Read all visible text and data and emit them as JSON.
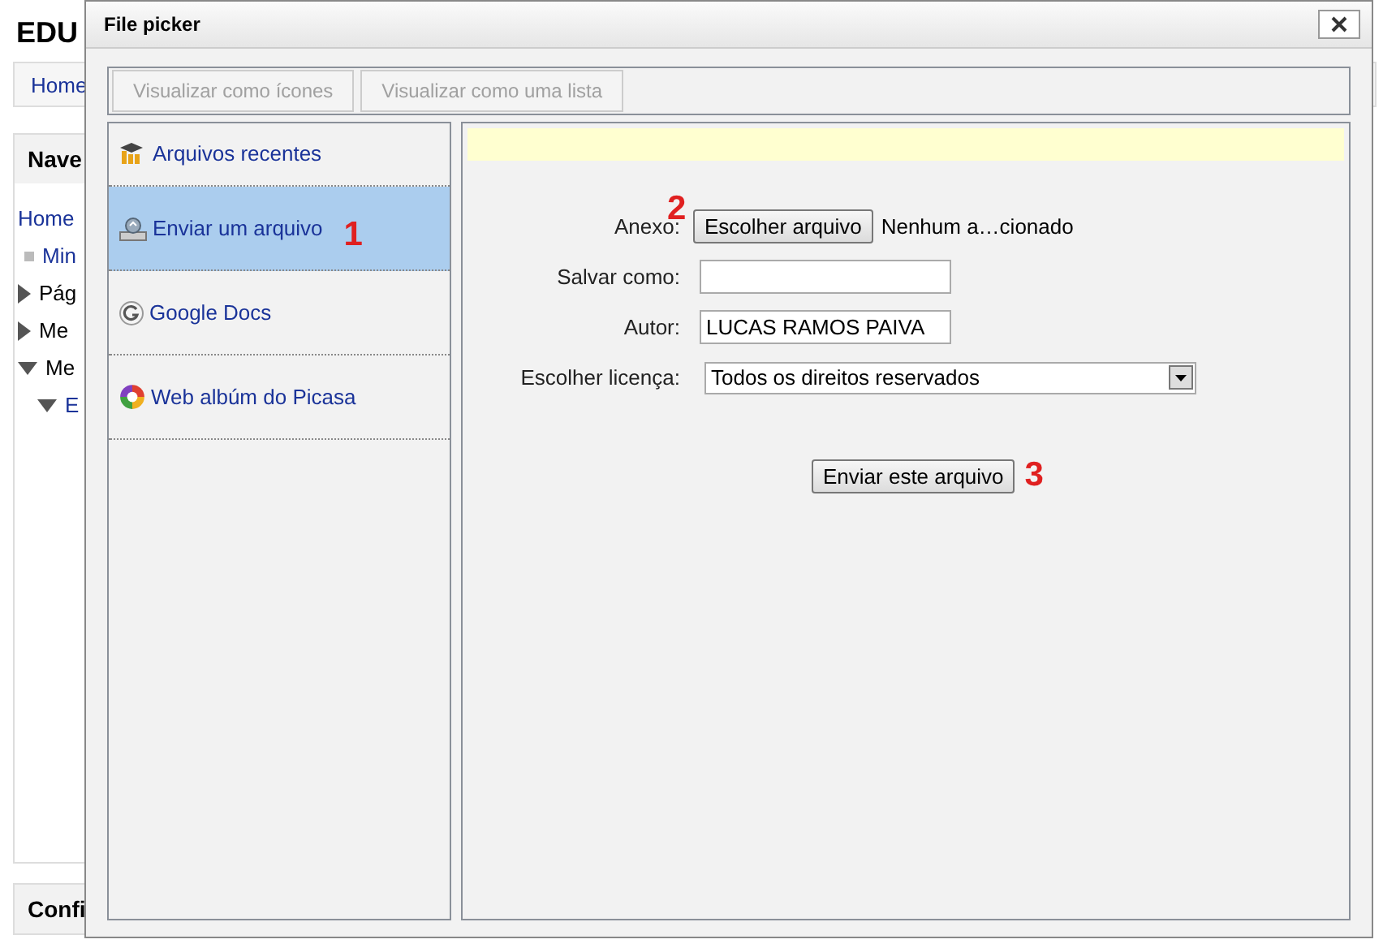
{
  "page": {
    "site_title": "EDU",
    "breadcrumb": "Home",
    "nav_block": {
      "title": "Nave",
      "items": [
        {
          "label": "Home",
          "kind": "link"
        },
        {
          "label": "Min",
          "kind": "bullet"
        },
        {
          "label": "Pág",
          "kind": "collapsed"
        },
        {
          "label": "Me",
          "kind": "collapsed"
        },
        {
          "label": "Me",
          "kind": "expanded"
        },
        {
          "label": "E",
          "kind": "expanded-link"
        }
      ]
    },
    "config_block": {
      "title": "Confi"
    }
  },
  "dialog": {
    "title": "File picker",
    "toolbar": [
      {
        "label": "Visualizar como ícones",
        "disabled": true
      },
      {
        "label": "Visualizar como uma lista",
        "disabled": true
      }
    ],
    "repositories": [
      {
        "label": "Arquivos recentes",
        "kind": "recent",
        "selected": false
      },
      {
        "label": "Enviar um arquivo",
        "kind": "upload",
        "selected": true,
        "annotation": "1"
      },
      {
        "label": "Google Docs",
        "kind": "google",
        "selected": false
      },
      {
        "label": "Web albúm do Picasa",
        "kind": "picasa",
        "selected": false
      }
    ],
    "form": {
      "attachment": {
        "label": "Anexo:",
        "annotation": "2",
        "button": "Escolher arquivo",
        "status": "Nenhum a…cionado"
      },
      "fields": [
        {
          "label": "Salvar como:"
        },
        {
          "label": "Autor:",
          "value": "LUCAS RAMOS PAIVA"
        }
      ],
      "license": {
        "label": "Escolher licença:",
        "value": "Todos os direitos reservados"
      },
      "submit": {
        "label": "Enviar este arquivo",
        "annotation": "3"
      }
    }
  }
}
